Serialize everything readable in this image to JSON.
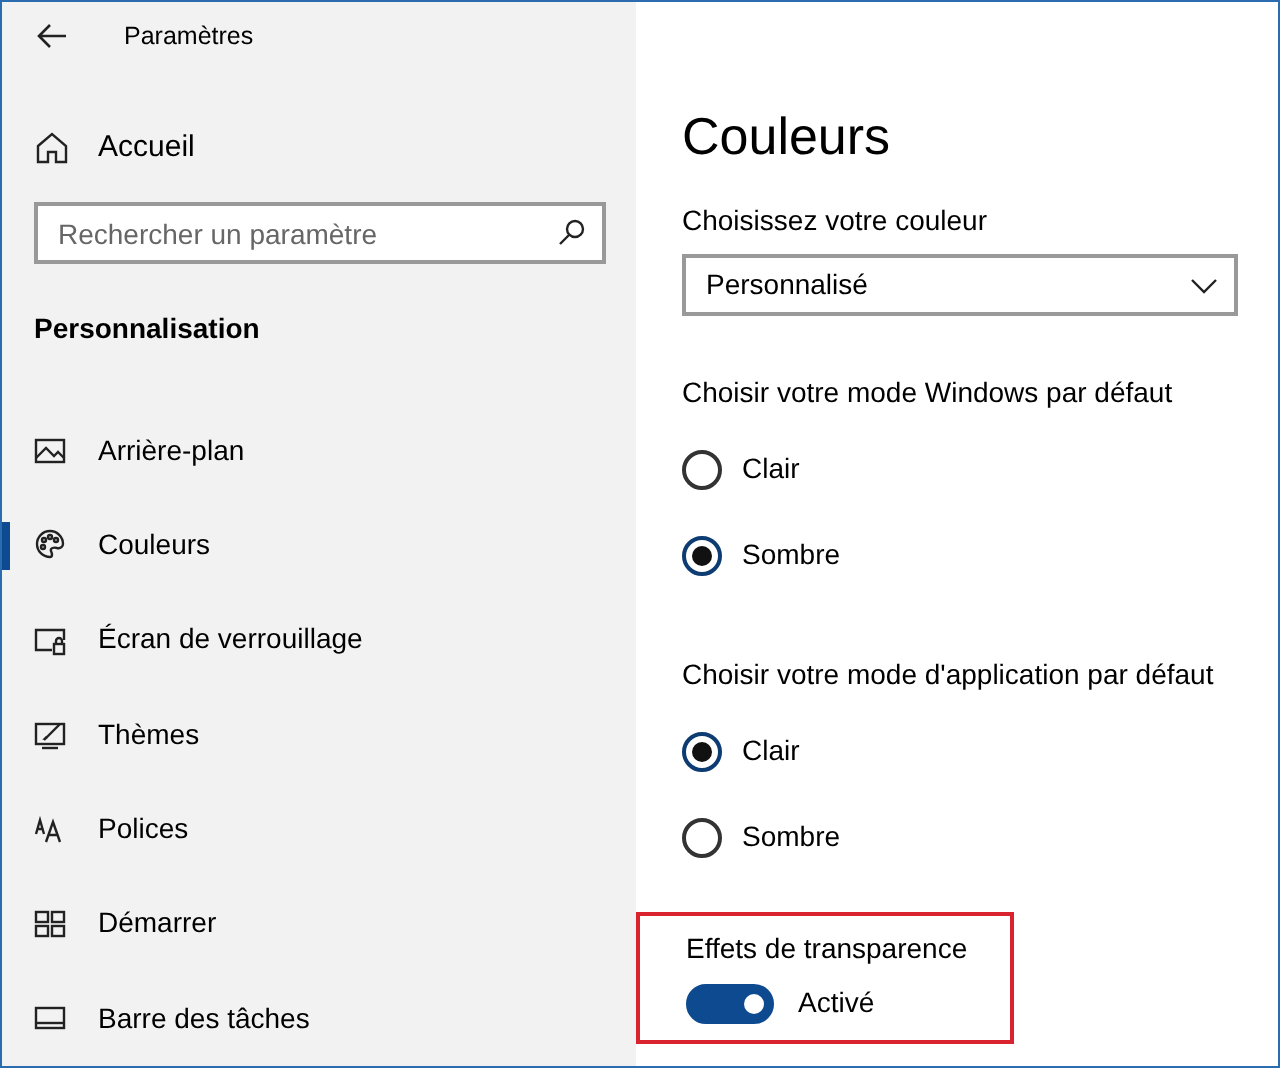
{
  "window": {
    "title": "Paramètres"
  },
  "sidebar": {
    "home": "Accueil",
    "search": {
      "placeholder": "Rechercher un paramètre"
    },
    "section": "Personnalisation",
    "items": [
      {
        "label": "Arrière-plan",
        "selected": false
      },
      {
        "label": "Couleurs",
        "selected": true
      },
      {
        "label": "Écran de verrouillage",
        "selected": false
      },
      {
        "label": "Thèmes",
        "selected": false
      },
      {
        "label": "Polices",
        "selected": false
      },
      {
        "label": "Démarrer",
        "selected": false
      },
      {
        "label": "Barre des tâches",
        "selected": false
      }
    ]
  },
  "main": {
    "title": "Couleurs",
    "color_choice": {
      "label": "Choisissez votre couleur",
      "value": "Personnalisé"
    },
    "groups": [
      {
        "label": "Choisir votre mode Windows par défaut",
        "options": [
          {
            "label": "Clair",
            "selected": false
          },
          {
            "label": "Sombre",
            "selected": true
          }
        ]
      },
      {
        "label": "Choisir votre mode d'application par défaut",
        "options": [
          {
            "label": "Clair",
            "selected": true
          },
          {
            "label": "Sombre",
            "selected": false
          }
        ]
      }
    ],
    "transparency": {
      "label": "Effets de transparence",
      "on": true,
      "state_label": "Activé",
      "highlighted": true
    }
  }
}
